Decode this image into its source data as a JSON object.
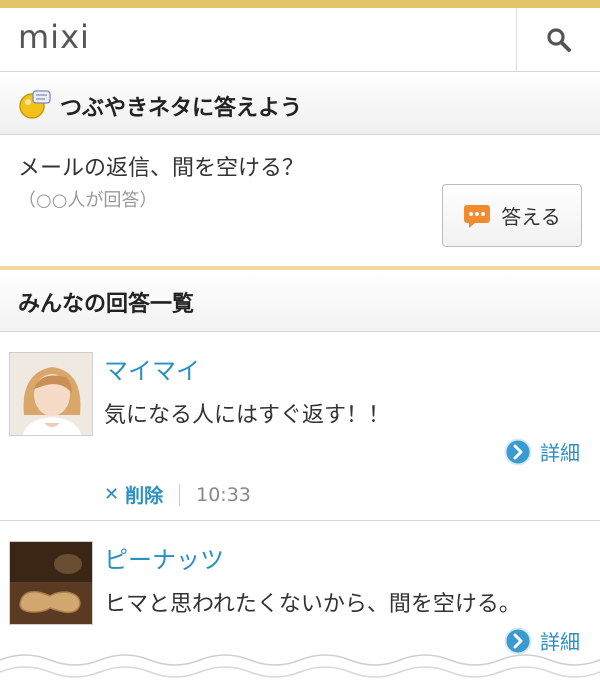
{
  "colors": {
    "accent_bar": "#e3c468",
    "link": "#2a8fc1",
    "chat_icon": "#f28a2f",
    "detail_icon": "#3a9bd0"
  },
  "header": {
    "logo": "mixi",
    "search_icon": "magnifier-icon"
  },
  "section": {
    "title": "つぶやきネタに答えよう",
    "icon": "lightbulb-icon"
  },
  "question": {
    "text": "メールの返信、間を空ける？",
    "count": "（○○人が回答）",
    "answer_button": "答える"
  },
  "list": {
    "title": "みんなの回答一覧",
    "entries": [
      {
        "name": "マイマイ",
        "answer": "気になる人にはすぐ返す！！",
        "detail": "詳細",
        "delete": "削除",
        "time": "10:33"
      },
      {
        "name": "ピーナッツ",
        "answer": "ヒマと思われたくないから、間を空ける。",
        "detail": "詳細"
      }
    ]
  }
}
